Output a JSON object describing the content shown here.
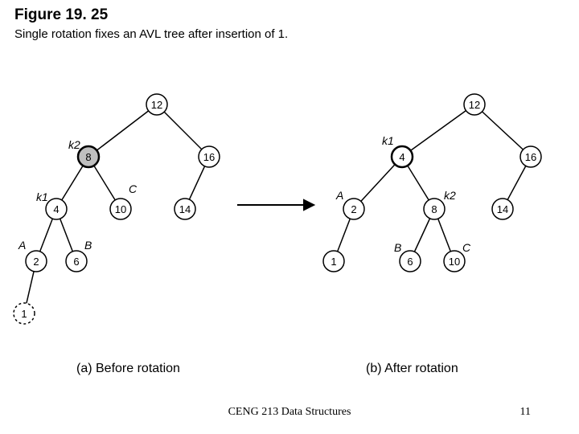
{
  "figure_number": "Figure 19. 25",
  "figure_caption": "Single rotation fixes an AVL tree after insertion of 1.",
  "caption_a": "(a) Before rotation",
  "caption_b": "(b) After rotation",
  "footer_center": "CENG 213 Data Structures",
  "footer_right": "11",
  "tree_a": {
    "labels": {
      "k1": "k1",
      "k2": "k2",
      "A": "A",
      "B": "B",
      "C": "C"
    },
    "nodes": {
      "n12": "12",
      "n8": "8",
      "n16": "16",
      "n4": "4",
      "n10": "10",
      "n14": "14",
      "n2": "2",
      "n6": "6",
      "n1": "1"
    }
  },
  "tree_b": {
    "labels": {
      "k1": "k1",
      "k2": "k2",
      "A": "A",
      "B": "B",
      "C": "C"
    },
    "nodes": {
      "n12": "12",
      "n4": "4",
      "n16": "16",
      "n2": "2",
      "n8": "8",
      "n14": "14",
      "n1": "1",
      "n6": "6",
      "n10": "10"
    }
  },
  "chart_data": {
    "type": "diagram",
    "title": "Single rotation fixes an AVL tree after insertion of 1.",
    "before": {
      "annotations": {
        "k2": 8,
        "k1": 4,
        "A": 2,
        "B": 6,
        "C": 10
      },
      "edges": [
        [
          12,
          8
        ],
        [
          12,
          16
        ],
        [
          8,
          4
        ],
        [
          8,
          10
        ],
        [
          16,
          14
        ],
        [
          4,
          2
        ],
        [
          4,
          6
        ],
        [
          2,
          1
        ]
      ],
      "inserted": 1,
      "highlighted": 8
    },
    "after": {
      "annotations": {
        "k1": 4,
        "k2": 8,
        "A": 2,
        "B": 6,
        "C": 10
      },
      "edges": [
        [
          12,
          4
        ],
        [
          12,
          16
        ],
        [
          4,
          2
        ],
        [
          4,
          8
        ],
        [
          16,
          14
        ],
        [
          2,
          1
        ],
        [
          8,
          6
        ],
        [
          8,
          10
        ]
      ]
    }
  }
}
